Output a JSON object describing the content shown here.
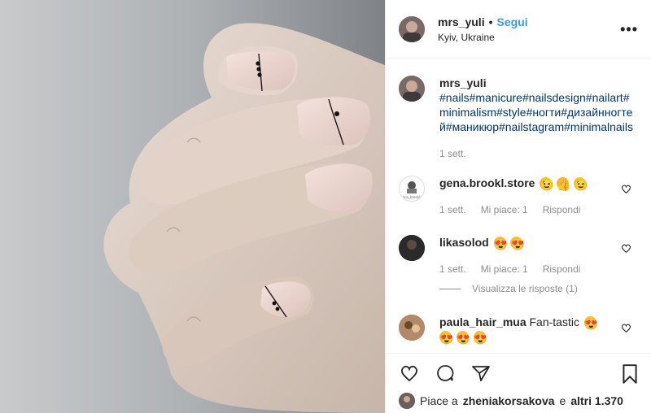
{
  "post": {
    "author": "mrs_yuli",
    "separator": "•",
    "follow_label": "Segui",
    "location": "Kyiv, Ukraine",
    "more_label": "•••"
  },
  "caption": {
    "author": "mrs_yuli",
    "text": "#nails#manicure#nailsdesign#nailart#minimalism#style#ногти#дизайнногтей#маникюр#nailstagram#minimalnails",
    "time": "1 sett."
  },
  "comments": [
    {
      "username": "gena.brookl.store",
      "avatar_text": "gena_brooklin",
      "emoji": [
        "😉",
        "👍",
        "😉"
      ],
      "time": "1 sett.",
      "likes": "Mi piace: 1",
      "reply": "Rispondi"
    },
    {
      "username": "likasolod",
      "emoji": [
        "😍",
        "😍"
      ],
      "time": "1 sett.",
      "likes": "Mi piace: 1",
      "reply": "Rispondi",
      "view_replies": "Visualizza le risposte (1)"
    },
    {
      "username": "paula_hair_mua",
      "text": "Fan-tastic",
      "emoji": [
        "😍",
        "😍",
        "😍",
        "😍"
      ]
    }
  ],
  "likes_line": {
    "prefix": "Piace a",
    "user": "zheniakorsakova",
    "conj": "e",
    "others": "altri 1.370"
  },
  "icons": [
    "heart-icon",
    "comment-icon",
    "share-icon",
    "bookmark-icon",
    "more-icon"
  ],
  "colors": {
    "link": "#003569",
    "follow": "#3897f0",
    "muted": "#8e8e8e"
  }
}
